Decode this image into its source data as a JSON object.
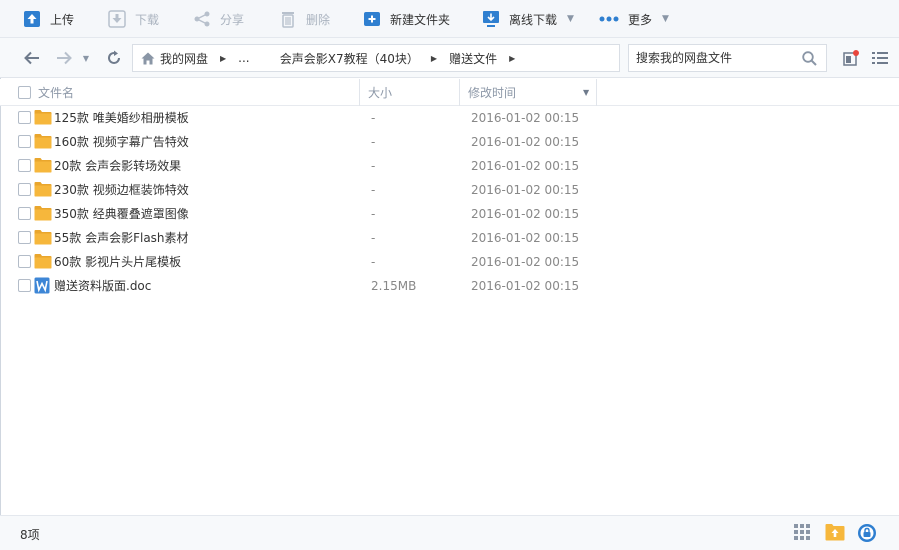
{
  "toolbar": {
    "upload": "上传",
    "download": "下载",
    "share": "分享",
    "delete": "删除",
    "new_folder": "新建文件夹",
    "offline_download": "离线下载",
    "more": "更多"
  },
  "breadcrumb": {
    "root": "我的网盘",
    "ellipsis": "...",
    "parent": "会声会影X7教程（40块）",
    "current": "赠送文件"
  },
  "search": {
    "placeholder": "搜索我的网盘文件"
  },
  "columns": {
    "name": "文件名",
    "size": "大小",
    "modified": "修改时间"
  },
  "files": [
    {
      "name": "125款 唯美婚纱相册模板",
      "size": "-",
      "modified": "2016-01-02 00:15",
      "type": "folder"
    },
    {
      "name": "160款 视频字幕广告特效",
      "size": "-",
      "modified": "2016-01-02 00:15",
      "type": "folder"
    },
    {
      "name": "20款 会声会影转场效果",
      "size": "-",
      "modified": "2016-01-02 00:15",
      "type": "folder"
    },
    {
      "name": "230款 视频边框装饰特效",
      "size": "-",
      "modified": "2016-01-02 00:15",
      "type": "folder"
    },
    {
      "name": "350款 经典覆叠遮罩图像",
      "size": "-",
      "modified": "2016-01-02 00:15",
      "type": "folder"
    },
    {
      "name": "55款 会声会影Flash素材",
      "size": "-",
      "modified": "2016-01-02 00:15",
      "type": "folder"
    },
    {
      "name": "60款 影视片头片尾模板",
      "size": "-",
      "modified": "2016-01-02 00:15",
      "type": "folder"
    },
    {
      "name": "赠送资料版面.doc",
      "size": "2.15MB",
      "modified": "2016-01-02 00:15",
      "type": "doc"
    }
  ],
  "status": {
    "count": "8项"
  },
  "colors": {
    "accent": "#2f7fd0",
    "folder": "#f6b73c",
    "doc": "#3d86d6",
    "badge": "#e8453c"
  }
}
